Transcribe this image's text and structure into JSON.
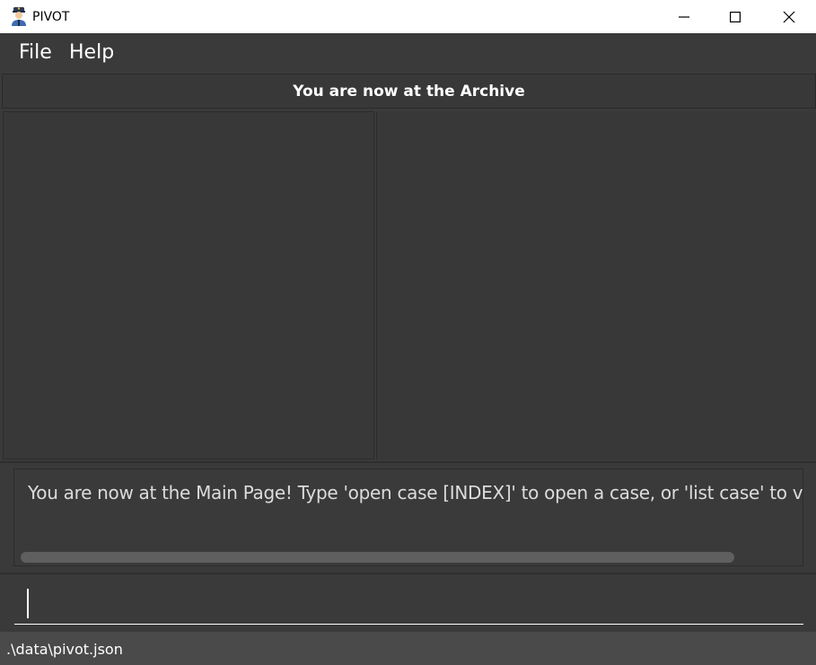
{
  "window": {
    "title": "PIVOT",
    "app_icon": "police-officer-icon"
  },
  "menu": {
    "items": [
      {
        "label": "File"
      },
      {
        "label": "Help"
      }
    ]
  },
  "header": {
    "text": "You are now at the Archive"
  },
  "result_display": {
    "text": "You are now at the Main Page! Type 'open case [INDEX]' to open a case, or 'list case' to view all"
  },
  "command_box": {
    "value": "",
    "placeholder": ""
  },
  "status_bar": {
    "path": ".\\data\\pivot.json"
  },
  "colors": {
    "background": "#3a3a3a",
    "status_bar": "#4a4a4a",
    "text": "#ffffff"
  }
}
